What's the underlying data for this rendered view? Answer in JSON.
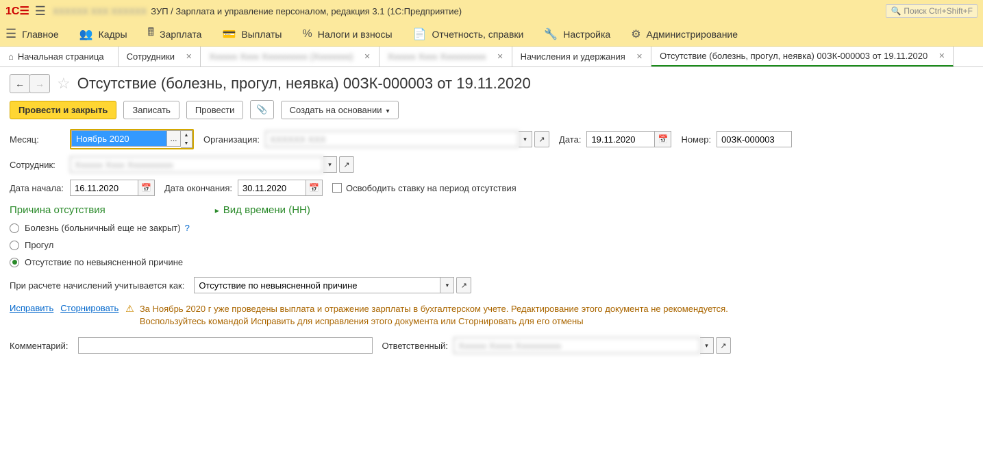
{
  "topbar": {
    "app_title": "ЗУП / Зарплата и управление персоналом, редакция 3.1  (1С:Предприятие)",
    "search_placeholder": "Поиск Ctrl+Shift+F"
  },
  "mainmenu": [
    {
      "label": "Главное"
    },
    {
      "label": "Кадры"
    },
    {
      "label": "Зарплата"
    },
    {
      "label": "Выплаты"
    },
    {
      "label": "Налоги и взносы"
    },
    {
      "label": "Отчетность, справки"
    },
    {
      "label": "Настройка"
    },
    {
      "label": "Администрирование"
    }
  ],
  "tabs": {
    "home": "Начальная страница",
    "t1": "Сотрудники",
    "t4": "Начисления и удержания",
    "t5": "Отсутствие (болезнь, прогул, неявка) 00ЗК-000003 от 19.11.2020"
  },
  "doc": {
    "title": "Отсутствие (болезнь, прогул, неявка) 00ЗК-000003 от 19.11.2020"
  },
  "toolbar": {
    "post_close": "Провести и закрыть",
    "save": "Записать",
    "post": "Провести",
    "create_based": "Создать на основании"
  },
  "fields": {
    "month_lbl": "Месяц:",
    "month_val": "Ноябрь 2020",
    "org_lbl": "Организация:",
    "date_lbl": "Дата:",
    "date_val": "19.11.2020",
    "number_lbl": "Номер:",
    "number_val": "00ЗК-000003",
    "employee_lbl": "Сотрудник:",
    "start_lbl": "Дата начала:",
    "start_val": "16.11.2020",
    "end_lbl": "Дата окончания:",
    "end_val": "30.11.2020",
    "release_lbl": "Освободить ставку на период отсутствия"
  },
  "sections": {
    "reason": "Причина отсутствия",
    "time_kind": "Вид времени (НН)"
  },
  "reasons": {
    "r1": "Болезнь (больничный еще не закрыт)",
    "r2": "Прогул",
    "r3": "Отсутствие по невыясненной причине"
  },
  "calc": {
    "lbl": "При расчете начислений учитывается как:",
    "val": "Отсутствие по невыясненной причине"
  },
  "warn": {
    "fix": "Исправить",
    "reverse": "Сторнировать",
    "text1": "За Ноябрь 2020 г уже проведены выплата и отражение зарплаты в бухгалтерском учете. Редактирование этого документа не рекомендуется.",
    "text2": "Воспользуйтесь командой Исправить для исправления этого документа или Сторнировать для его отмены"
  },
  "footer": {
    "comment_lbl": "Комментарий:",
    "resp_lbl": "Ответственный:"
  }
}
